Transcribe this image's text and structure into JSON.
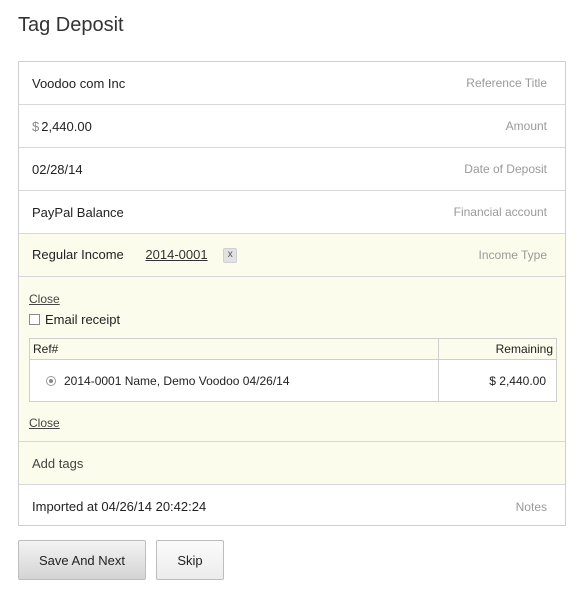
{
  "page": {
    "title": "Tag Deposit"
  },
  "form": {
    "reference": {
      "value": "Voodoo com Inc",
      "label": "Reference Title"
    },
    "amount": {
      "currency": "$",
      "value": "2,440.00",
      "label": "Amount"
    },
    "date": {
      "value": "02/28/14",
      "label": "Date of Deposit"
    },
    "account": {
      "value": "PayPal Balance",
      "label": "Financial account"
    },
    "income_type": {
      "value": "Regular Income",
      "ref_link": "2014-0001",
      "remove": "x",
      "label": "Income Type"
    }
  },
  "match_panel": {
    "close_top": "Close",
    "email_receipt": "Email receipt",
    "table": {
      "headers": [
        "Ref#",
        "Remaining"
      ],
      "rows": [
        {
          "ref": "2014-0001 Name, Demo Voodoo 04/26/14",
          "remaining": "$ 2,440.00"
        }
      ]
    },
    "close_bottom": "Close"
  },
  "tags": {
    "placeholder": "Add tags"
  },
  "notes": {
    "value": "Imported at 04/26/14 20:42:24",
    "label": "Notes"
  },
  "buttons": {
    "save_next": "Save And Next",
    "skip": "Skip"
  }
}
